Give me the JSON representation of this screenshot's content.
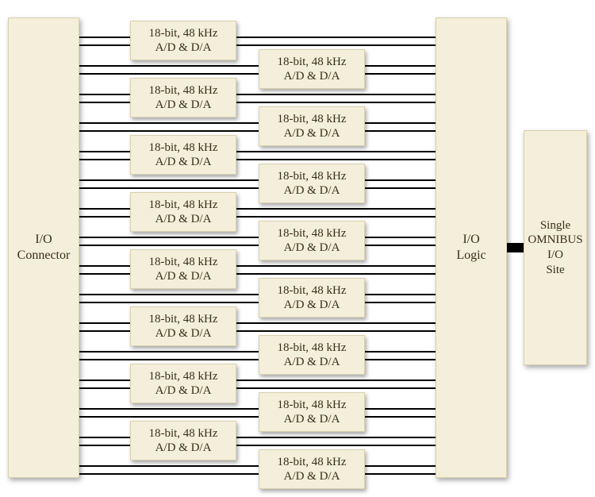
{
  "panels": {
    "connector": {
      "line1": "I/O",
      "line2": "Connector"
    },
    "iologic": {
      "line1": "I/O",
      "line2": "Logic"
    },
    "omnibus": {
      "line1": "Single",
      "line2": "OMNIBUS I/O",
      "line3": "Site"
    }
  },
  "converter_label": {
    "line1": "18-bit, 48 kHz",
    "line2": "A/D & D/A"
  },
  "left_column_count": 8,
  "right_column_count": 8,
  "colors": {
    "box_bg": "#f4efda",
    "box_border": "#d8d0b0",
    "text": "#3a2e18"
  }
}
